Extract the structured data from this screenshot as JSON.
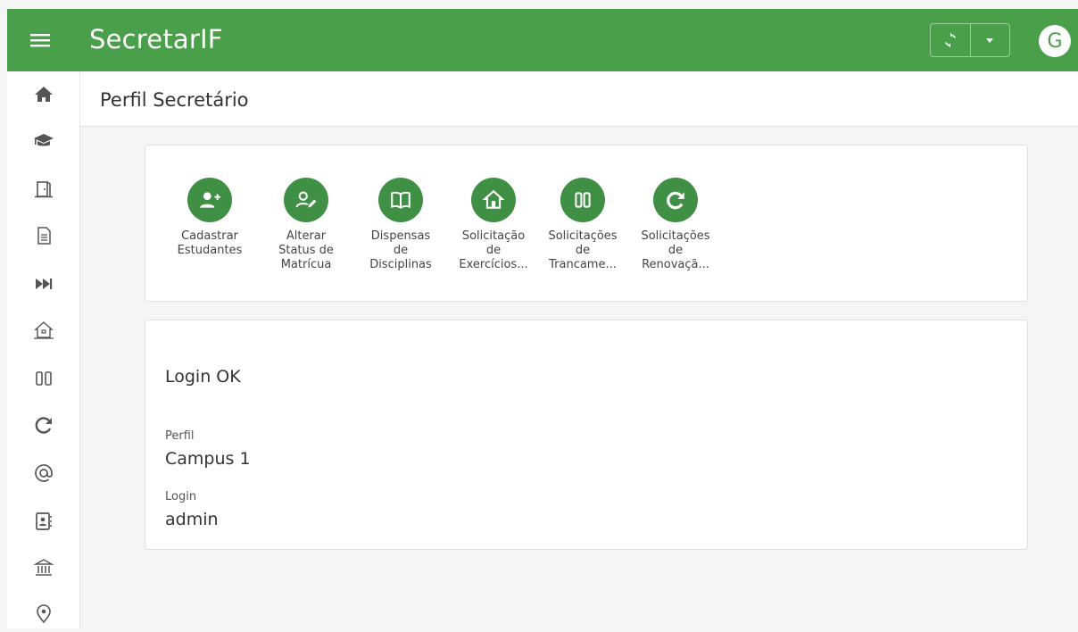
{
  "header": {
    "title": "SecretarIF",
    "avatar_letter": "G",
    "bar_color": "#4aa04a"
  },
  "sidebar": {
    "items": [
      {
        "icon": "home-icon"
      },
      {
        "icon": "graduation-cap-icon"
      },
      {
        "icon": "door-icon"
      },
      {
        "icon": "document-icon"
      },
      {
        "icon": "fast-forward-icon"
      },
      {
        "icon": "house-outline-icon"
      },
      {
        "icon": "pause-icon"
      },
      {
        "icon": "redo-icon"
      },
      {
        "icon": "at-icon"
      },
      {
        "icon": "contact-book-icon"
      },
      {
        "icon": "institution-icon"
      },
      {
        "icon": "location-pin-icon"
      }
    ]
  },
  "page": {
    "title": "Perfil Secretário"
  },
  "actions": [
    {
      "label": "Cadastrar\nEstudantes",
      "icon": "add-user-icon"
    },
    {
      "label": "Alterar\nStatus de\nMatrícua",
      "icon": "edit-user-icon"
    },
    {
      "label": "Dispensas\nde\nDisciplinas",
      "icon": "book-icon"
    },
    {
      "label": "Solicitação\nde\nExercícios...",
      "icon": "house-icon"
    },
    {
      "label": "Solicitações\nde\nTrancame...",
      "icon": "pause-icon"
    },
    {
      "label": "Solicitações\nde\nRenovaçã...",
      "icon": "redo-icon"
    }
  ],
  "info": {
    "status": "Login OK",
    "profile_label": "Perfil",
    "profile_value": "Campus 1",
    "login_label": "Login",
    "login_value": "admin"
  },
  "colors": {
    "accent": "#4aa04a",
    "action_circle": "#3f8f45"
  }
}
